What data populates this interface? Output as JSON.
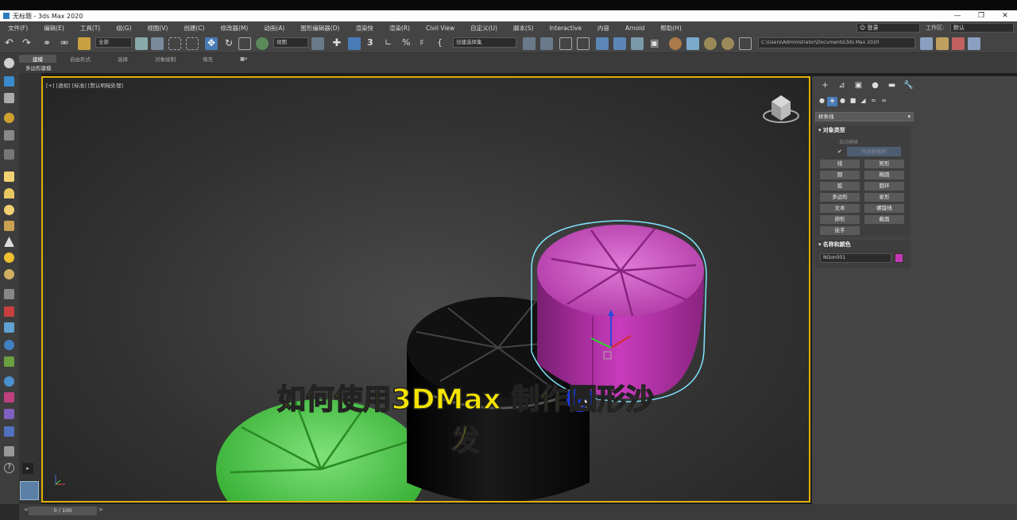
{
  "window": {
    "title": "无标题 - 3ds Max 2020",
    "controls": [
      "—",
      "❐",
      "✕"
    ]
  },
  "menu": [
    "文件(F)",
    "编辑(E)",
    "工具(T)",
    "组(G)",
    "视图(V)",
    "创建(C)",
    "修改器(M)",
    "动画(A)",
    "图形编辑器(D)",
    "渲染快",
    "渲染(R)",
    "Civil View",
    "自定义(U)",
    "脚本(S)",
    "Interactive",
    "内容",
    "Arnold",
    "帮助(H)"
  ],
  "user": {
    "label": "登录"
  },
  "workspace": {
    "label": "工作区:",
    "value": "默认"
  },
  "toolbar": {
    "filter": "全部",
    "refcoord": "视图",
    "selset": "创建选择集",
    "path": "C:\\Users\\Administrator\\Documents\\3ds Max 2020"
  },
  "ribbon": {
    "tabs": [
      "建模",
      "自由形式",
      "选择",
      "对象绘制",
      "填充"
    ],
    "active": 0,
    "sub": "多边形建模"
  },
  "viewport": {
    "label": "[+] [透视] [标准] [默认明暗处理]",
    "subtitle": "如何使用3DMax 制作圆形沙发",
    "colors": {
      "green": "#3ec83a",
      "black": "#0d0d0d",
      "magenta": "#c23ab5",
      "selection": "#7fe6ff"
    }
  },
  "command_panel": {
    "tabs": [
      "+",
      "⊿",
      "▣",
      "●",
      "▬",
      "🔧"
    ],
    "category": "样条线",
    "object_type": {
      "title": "对象类型",
      "autogrid": "自动栅格",
      "start_new": "开始新图形",
      "buttons": [
        "线",
        "矩形",
        "圆",
        "椭圆",
        "弧",
        "圆环",
        "多边形",
        "星形",
        "文本",
        "螺旋线",
        "卵形",
        "截面",
        "徒手"
      ]
    },
    "name_color": {
      "title": "名称和颜色",
      "name": "NGon001",
      "color": "#c738b7"
    }
  },
  "timeline": {
    "frame": "0 / 100",
    "left_arrow": "<",
    "right_arrow": ">"
  }
}
